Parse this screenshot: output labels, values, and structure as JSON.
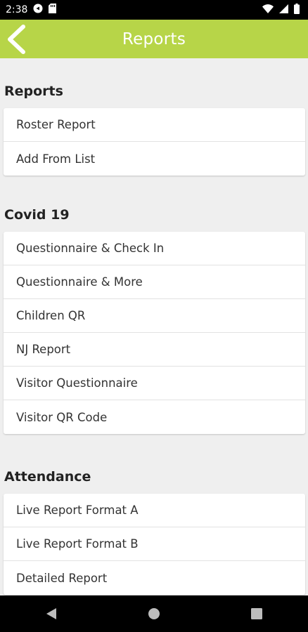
{
  "status_bar": {
    "time": "2:38"
  },
  "header": {
    "title": "Reports"
  },
  "sections": [
    {
      "title": "Reports",
      "items": [
        "Roster Report",
        "Add From List"
      ]
    },
    {
      "title": "Covid 19",
      "items": [
        "Questionnaire & Check In",
        "Questionnaire & More",
        "Children QR",
        "NJ Report",
        "Visitor Questionnaire",
        "Visitor QR Code"
      ]
    },
    {
      "title": "Attendance",
      "items": [
        "Live Report Format A",
        "Live Report Format B",
        "Detailed Report"
      ]
    }
  ],
  "colors": {
    "accent": "#b7d548",
    "background": "#efefef"
  },
  "icons": {
    "back": "chevron-left-icon",
    "nav_back": "triangle-back-icon",
    "nav_home": "circle-home-icon",
    "nav_recents": "square-recents-icon"
  }
}
